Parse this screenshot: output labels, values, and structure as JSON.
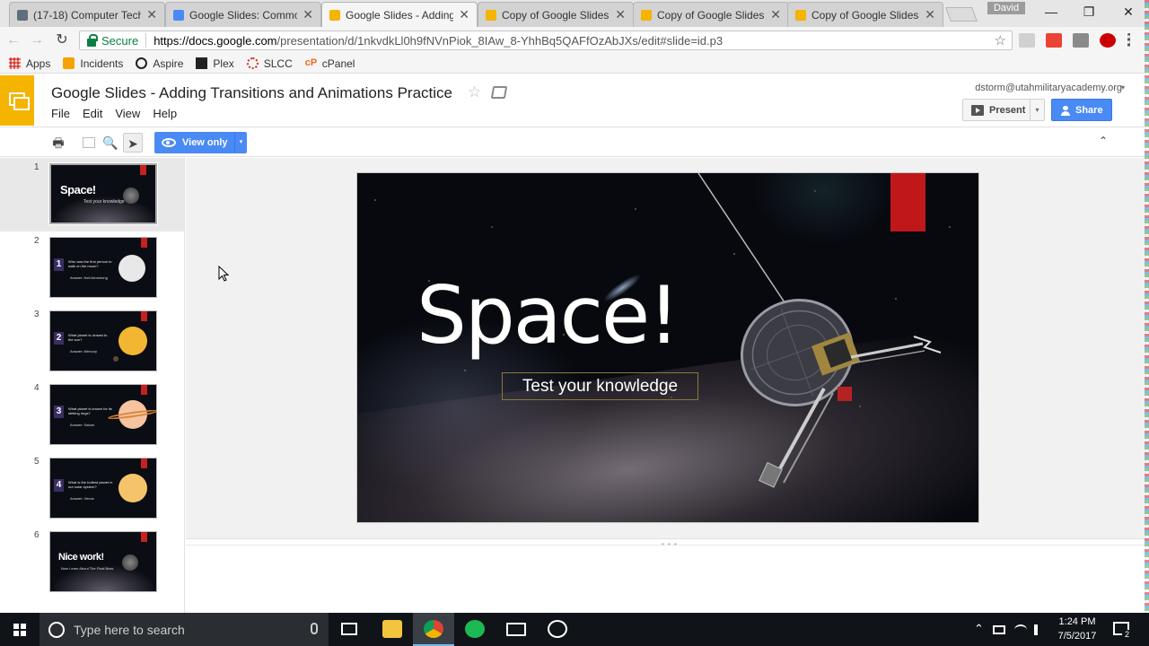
{
  "browser": {
    "tabs": [
      {
        "title": "(17-18) Computer Tech",
        "favicon": "classroom-icon"
      },
      {
        "title": "Google Slides: Commo",
        "favicon": "docs-icon"
      },
      {
        "title": "Google Slides - Adding",
        "favicon": "slides-icon",
        "active": true
      },
      {
        "title": "Copy of Google Slides",
        "favicon": "slides-icon"
      },
      {
        "title": "Copy of Google Slides",
        "favicon": "slides-icon"
      },
      {
        "title": "Copy of Google Slides",
        "favicon": "slides-icon"
      }
    ],
    "tab_close": "✕",
    "profile_name": "David",
    "window_controls": {
      "minimize": "—",
      "restore": "❐",
      "close": "✕"
    },
    "nav": {
      "back": "←",
      "forward": "→",
      "reload": "↻"
    },
    "secure_label": "Secure",
    "url_host": "https://docs.google.com",
    "url_path": "/presentation/d/1nkvdkLl0h9fNVnPiok_8IAw_8-YhhBq5QAFfOzAbJXs/edit#slide=id.p3",
    "bookmark_star": "☆",
    "bookmarks": [
      {
        "label": "Apps",
        "color": "#d93025"
      },
      {
        "label": "Incidents",
        "color": "#f4a300"
      },
      {
        "label": "Aspire",
        "color": "#222222"
      },
      {
        "label": "Plex",
        "color": "#e5a00d"
      },
      {
        "label": "SLCC",
        "color": "#c0392b"
      },
      {
        "label": "cPanel",
        "color": "#f26a1b"
      }
    ]
  },
  "app": {
    "doc_title": "Google Slides - Adding Transitions and Animations Practice",
    "title_star": "☆",
    "menu": [
      "File",
      "Edit",
      "View",
      "Help"
    ],
    "account_email": "dstorm@utahmilitaryacademy.org",
    "account_caret": "▾",
    "present_label": "Present",
    "present_caret": "▾",
    "share_label": "Share",
    "accent": "#4a8af4",
    "brand": "#f4b400"
  },
  "toolbar": {
    "print": "🖶",
    "zoom": "🔍",
    "select": "➤",
    "view_only_label": "View only",
    "view_only_caret": "▾",
    "collapse": "⌃"
  },
  "filmstrip": {
    "slides": [
      {
        "num": "1",
        "kind": "title",
        "title": "Space!",
        "subtitle": "Test your knowledge"
      },
      {
        "num": "2",
        "kind": "question",
        "qnum": "1",
        "question": "Who was the first person to walk on the moon?",
        "answer": "Answer: Neil Armstrong",
        "planet_color": "#e8e8e8"
      },
      {
        "num": "3",
        "kind": "question",
        "qnum": "2",
        "question": "What planet is closest to the sun?",
        "answer": "Answer: Mercury",
        "planet_color": "#f2b632"
      },
      {
        "num": "4",
        "kind": "question",
        "qnum": "3",
        "question": "What planet is known for its striking rings?",
        "answer": "Answer: Saturn",
        "planet_color": "#f6c4a0"
      },
      {
        "num": "5",
        "kind": "question",
        "qnum": "4",
        "question": "What is the hottest planet in our solar system?",
        "answer": "Answer: Venus",
        "planet_color": "#f5c46a"
      },
      {
        "num": "6",
        "kind": "title",
        "title": "Nice work!",
        "subtitle": "Now Learn About The Final Boss"
      }
    ]
  },
  "slide": {
    "title": "Space!",
    "subtitle": "Test your knowledge",
    "red_accent": "#c0181a"
  },
  "taskbar": {
    "search_placeholder": "Type here to search",
    "apps": [
      "task-view",
      "file-explorer",
      "chrome",
      "spotify",
      "mail",
      "camera"
    ],
    "tray_up": "⌃",
    "time": "1:24 PM",
    "date": "7/5/2017",
    "notification_count": "2"
  }
}
